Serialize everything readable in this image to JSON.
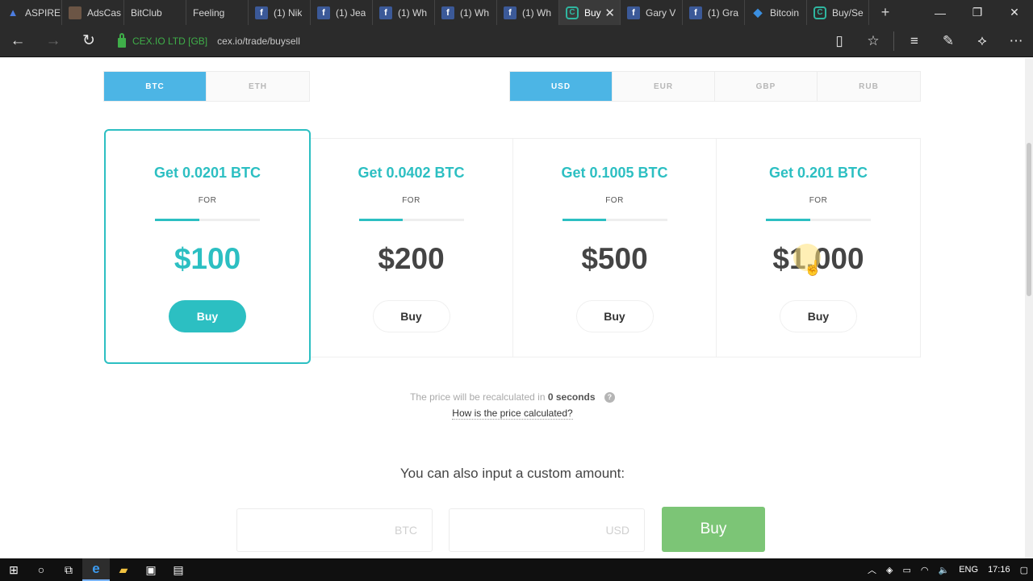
{
  "browser": {
    "tabs": [
      {
        "label": "ASPIRE",
        "icon": "aspire-icon"
      },
      {
        "label": "AdsCas",
        "icon": "adscash-icon"
      },
      {
        "label": "BitClub",
        "icon": "page-icon"
      },
      {
        "label": "Feeling",
        "icon": "page-icon"
      },
      {
        "label": "(1) Nik",
        "icon": "facebook-icon"
      },
      {
        "label": "(1) Jea",
        "icon": "facebook-icon"
      },
      {
        "label": "(1) Wh",
        "icon": "facebook-icon"
      },
      {
        "label": "(1) Wh",
        "icon": "facebook-icon"
      },
      {
        "label": "(1) Wh",
        "icon": "facebook-icon"
      },
      {
        "label": "Buy",
        "icon": "cex-icon",
        "active": true
      },
      {
        "label": "Gary V",
        "icon": "facebook-icon"
      },
      {
        "label": "(1) Gra",
        "icon": "facebook-icon"
      },
      {
        "label": "Bitcoin",
        "icon": "bitcoin-icon"
      },
      {
        "label": "Buy/Se",
        "icon": "cex-icon"
      }
    ],
    "certificate": "CEX.IO LTD [GB]",
    "url": "cex.io/trade/buysell"
  },
  "page": {
    "crypto_tabs": [
      {
        "label": "BTC",
        "selected": true
      },
      {
        "label": "ETH",
        "selected": false
      }
    ],
    "fiat_tabs": [
      {
        "label": "USD",
        "selected": true
      },
      {
        "label": "EUR",
        "selected": false
      },
      {
        "label": "GBP",
        "selected": false
      },
      {
        "label": "RUB",
        "selected": false
      }
    ],
    "offers": [
      {
        "get": "Get 0.0201 BTC",
        "for": "FOR",
        "price": "$100",
        "buy": "Buy",
        "selected": true,
        "progress": 0.42
      },
      {
        "get": "Get 0.0402 BTC",
        "for": "FOR",
        "price": "$200",
        "buy": "Buy",
        "selected": false,
        "progress": 0.42
      },
      {
        "get": "Get 0.1005 BTC",
        "for": "FOR",
        "price": "$500",
        "buy": "Buy",
        "selected": false,
        "progress": 0.42
      },
      {
        "get": "Get 0.201 BTC",
        "for": "FOR",
        "price": "$1,000",
        "buy": "Buy",
        "selected": false,
        "progress": 0.42
      }
    ],
    "recalc_prefix": "The price will be recalculated in",
    "recalc_value": "0 seconds",
    "how_link": "How is the price calculated?",
    "custom_heading": "You can also input a custom amount:",
    "btc_placeholder": "BTC",
    "usd_placeholder": "USD",
    "custom_buy": "Buy"
  },
  "taskbar": {
    "language": "ENG",
    "time": "17:16"
  },
  "colors": {
    "accent_teal": "#2cbfc2",
    "tab_selected_blue": "#4cb5e5",
    "buy_green": "#7cc576"
  }
}
